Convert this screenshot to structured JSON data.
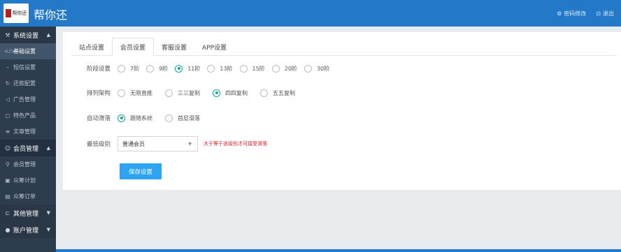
{
  "header": {
    "logo_text": "帮你还",
    "title": "帮你还",
    "actions": [
      {
        "icon": "key-icon",
        "label": "密码修改"
      },
      {
        "icon": "logout-icon",
        "label": "退出"
      }
    ]
  },
  "sidebar": {
    "groups": [
      {
        "label": "系统设置",
        "icon": "settings-icon",
        "items": [
          {
            "label": "基础设置",
            "icon": "code-icon",
            "selected": true
          },
          {
            "label": "短信设置",
            "icon": "minus-icon"
          },
          {
            "label": "还款配置",
            "icon": "refresh-icon"
          },
          {
            "label": "广告管理",
            "icon": "megaphone-icon"
          },
          {
            "label": "特色产品",
            "icon": "cube-icon"
          },
          {
            "label": "文章管理",
            "icon": "list-icon"
          }
        ]
      },
      {
        "label": "会员管理",
        "icon": "user-icon",
        "items": [
          {
            "label": "会员管理",
            "icon": "person-icon"
          },
          {
            "label": "众筹计划",
            "icon": "plan-icon"
          },
          {
            "label": "众筹订单",
            "icon": "order-icon"
          }
        ]
      },
      {
        "label": "其他管理",
        "icon": "other-icon",
        "items": []
      },
      {
        "label": "账户管理",
        "icon": "account-icon",
        "items": []
      }
    ]
  },
  "tabs": [
    {
      "label": "站点设置",
      "active": false
    },
    {
      "label": "会员设置",
      "active": true
    },
    {
      "label": "客服设置",
      "active": false
    },
    {
      "label": "APP设置",
      "active": false
    }
  ],
  "form": {
    "stage": {
      "label": "阶段设置",
      "options": [
        "7阶",
        "9阶",
        "11阶",
        "13阶",
        "15阶",
        "20阶",
        "30阶"
      ],
      "selected": "11阶"
    },
    "structure": {
      "label": "排列架构",
      "options": [
        "无限直推",
        "三三复制",
        "四四复制",
        "五五复制"
      ],
      "selected": "四四复制"
    },
    "slide": {
      "label": "自动滑落",
      "options": [
        "跟随系统",
        "首层滑落"
      ],
      "selected": "跟随系统"
    },
    "min_level": {
      "label": "最低级别",
      "value": "普通会员",
      "hint": "大于等于该级别才可接受滑落"
    },
    "save_label": "保存设置"
  },
  "colors": {
    "header": "#2378c8",
    "sidebar": "#2e3d4e",
    "accent_radio": "#1aa39a",
    "button": "#2ea3f2",
    "hint": "#e02020"
  }
}
